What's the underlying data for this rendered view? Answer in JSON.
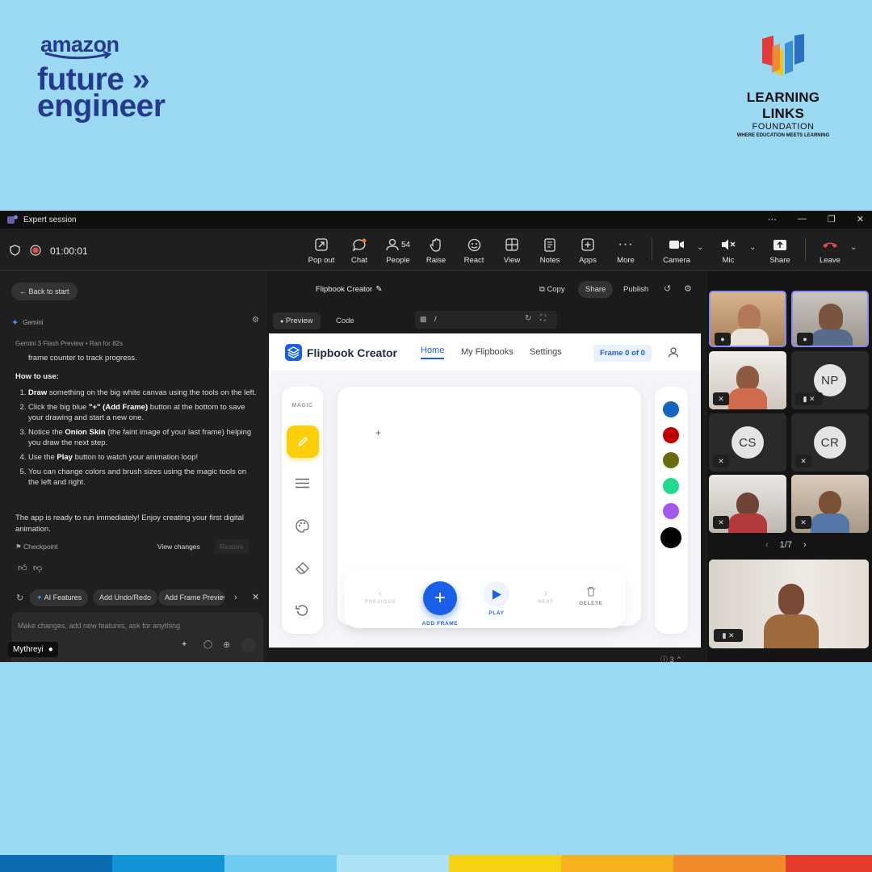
{
  "branding": {
    "amazon": "amazon",
    "future": "future",
    "engineer": "engineer",
    "llf_line1": "LEARNING LINKS",
    "llf_line2": "FOUNDATION",
    "llf_tagline": "WHERE EDUCATION MEETS LEARNING"
  },
  "window": {
    "title": "Expert session",
    "timer": "01:00:01"
  },
  "toolbar": {
    "popout": "Pop out",
    "chat": "Chat",
    "people": "People",
    "people_count": "54",
    "raise": "Raise",
    "react": "React",
    "view": "View",
    "notes": "Notes",
    "apps": "Apps",
    "more": "More",
    "camera": "Camera",
    "mic": "Mic",
    "share": "Share",
    "leave": "Leave"
  },
  "editor": {
    "back": "Back to start",
    "project": "Flipbook Creator",
    "copy": "Copy",
    "share": "Share",
    "publish": "Publish",
    "tab_preview": "Preview",
    "tab_code": "Code",
    "url": "/"
  },
  "chat": {
    "assistant": "Gemini",
    "model": "Gemini 3 Flash Preview",
    "ran": "Ran for 82s",
    "intro": "frame counter to track progress.",
    "howto": "How to use:",
    "steps": [
      {
        "bold": "Draw",
        "rest": " something on the big white canvas using the tools on the left."
      },
      {
        "pre": "Click the big blue ",
        "bold": "\"+\" (Add Frame)",
        "rest": " button at the bottom to save your drawing and start a new one."
      },
      {
        "pre": "Notice the ",
        "bold": "Onion Skin",
        "rest": " (the faint image of your last frame) helping you draw the next step."
      },
      {
        "pre": "Use the ",
        "bold": "Play",
        "rest": " button to watch your animation loop!"
      },
      {
        "pre": "",
        "bold": "",
        "rest": "You can change colors and brush sizes using the magic tools on the left and right."
      }
    ],
    "outro": "The app is ready to run immediately! Enjoy creating your first digital animation.",
    "checkpoint": "Checkpoint",
    "view_changes": "View changes",
    "restore": "Restore",
    "chip1": "AI Features",
    "chip2": "Add Undo/Redo",
    "chip3": "Add Frame Preview",
    "input_placeholder": "Make changes, add new features, ask for anything",
    "presenter": "Mythreyi"
  },
  "app": {
    "title": "Flipbook Creator",
    "nav_home": "Home",
    "nav_flipbooks": "My Flipbooks",
    "nav_settings": "Settings",
    "frame_badge": "Frame 0 of 0",
    "magic": "MAGIC",
    "previous": "PREVIOUS",
    "add_frame": "ADD FRAME",
    "play": "PLAY",
    "next": "NEXT",
    "delete": "DELETE",
    "palette": [
      "#1565c0",
      "#c00000",
      "#6b6b0f",
      "#21d88e",
      "#a259ef",
      "#000000"
    ]
  },
  "gallery": {
    "np": "NP",
    "cs": "CS",
    "cr": "CR",
    "page": "1/7"
  },
  "statusbar": {
    "issues": "3"
  },
  "colors": {
    "background": "#9bd9f3",
    "accent": "#1a5fe8",
    "magic_yellow": "#fccf0a",
    "leave_red": "#e8474a"
  }
}
